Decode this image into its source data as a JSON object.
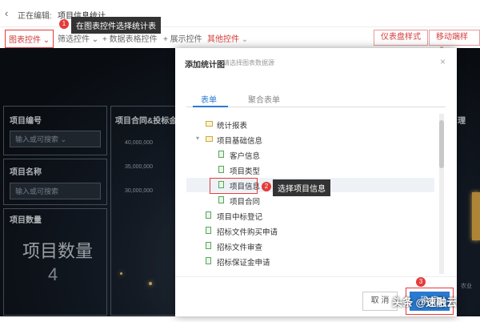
{
  "topbar": {
    "editing_label": "正在编辑:",
    "page_name": "项目信息统计"
  },
  "toolbar": {
    "chart_control": "图表控件",
    "filter_control": "筛选控件",
    "table_control": "数据表格控件",
    "display_control": "展示控件",
    "other_control": "其他控件",
    "dashboard_style": "仪表盘样式",
    "mobile_style": "移动端样式"
  },
  "callouts": {
    "step1_badge": "1",
    "step1_text": "在图表控件选择统计表",
    "step2_badge": "2",
    "step2_text": "选择项目信息",
    "step3_badge": "3"
  },
  "dashboard": {
    "project_no_title": "项目编号",
    "project_no_placeholder": "输入或可搜索",
    "contract_title": "项目合同&投标金",
    "project_name_title": "项目名称",
    "project_name_placeholder": "输入或可搜索",
    "project_count_title": "项目数量",
    "project_count_big": "项目数量",
    "project_count_value": "4",
    "tick_1": "40,000,000",
    "tick_2": "35,000,000",
    "tick_3": "30,000,000",
    "right_partial": "理",
    "right_partial_2": "农业"
  },
  "modal": {
    "title": "添加统计图",
    "subtitle": "请选择图表数据源",
    "tabs": [
      "表单",
      "聚合表单"
    ],
    "tree": [
      {
        "label": "统计报表",
        "type": "folder",
        "level": 1
      },
      {
        "label": "项目基础信息",
        "type": "folder",
        "level": 1,
        "expanded": true
      },
      {
        "label": "客户信息",
        "type": "doc",
        "level": 2
      },
      {
        "label": "项目类型",
        "type": "doc",
        "level": 2
      },
      {
        "label": "项目信息",
        "type": "doc",
        "level": 2,
        "selected": true
      },
      {
        "label": "项目合同",
        "type": "doc",
        "level": 2
      },
      {
        "label": "项目中标登记",
        "type": "doc",
        "level": 1
      },
      {
        "label": "招标文件购买申请",
        "type": "doc",
        "level": 1
      },
      {
        "label": "招标文件审查",
        "type": "doc",
        "level": 1
      },
      {
        "label": "招标保证金申请",
        "type": "doc",
        "level": 1
      }
    ],
    "cancel": "取 消",
    "ok": "确 定"
  },
  "watermark": "头条 @速融云"
}
